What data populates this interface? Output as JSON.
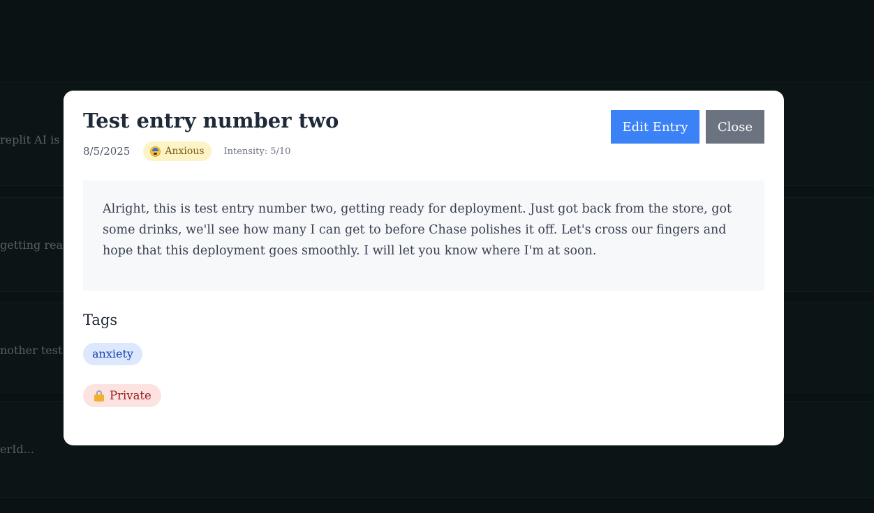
{
  "background": {
    "snippets": [
      "replit AI is c",
      "getting read",
      "nother test",
      "erId..."
    ]
  },
  "modal": {
    "title": "Test entry number two",
    "date": "8/5/2025",
    "mood": {
      "label": "Anxious",
      "icon": "anxious-face-icon",
      "color": "#fdf3c4"
    },
    "intensity": "Intensity: 5/10",
    "buttons": {
      "edit_label": "Edit Entry",
      "close_label": "Close"
    },
    "content": "Alright, this is test entry number two, getting ready for deployment. Just got back from the store, got some drinks, we'll see how many I can get to before Chase polishes it off. Let's cross our fingers and hope that this deployment goes smoothly. I will let you know where I'm at soon.",
    "tags_heading": "Tags",
    "tags": [
      "anxiety"
    ],
    "privacy": {
      "label": "Private",
      "icon": "lock-icon"
    }
  },
  "colors": {
    "primary": "#3b82f6",
    "secondary": "#6b7280",
    "tag_bg": "#dbe8fd",
    "private_bg": "#fde2e2"
  }
}
